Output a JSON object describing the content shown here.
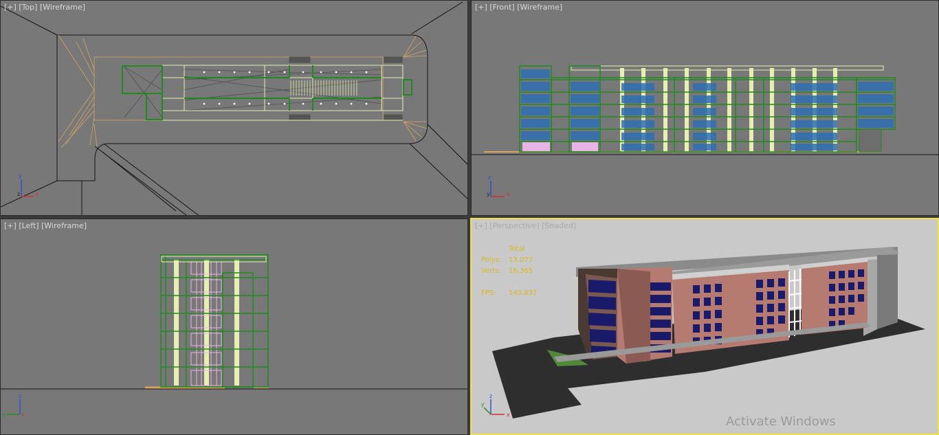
{
  "viewports": {
    "top": {
      "plus": "[+]",
      "view": "[Top]",
      "mode": "[Wireframe]"
    },
    "front": {
      "plus": "[+]",
      "view": "[Front]",
      "mode": "[Wireframe]"
    },
    "left": {
      "plus": "[+]",
      "view": "[Left]",
      "mode": "[Wireframe]"
    },
    "perspective": {
      "plus": "[+]",
      "view": "[Perspective]",
      "mode": "[Shaded]",
      "active": true
    }
  },
  "axes": {
    "x": "x",
    "y": "y",
    "z": "z"
  },
  "stats": {
    "header": "Total",
    "polys_label": "Polys:",
    "polys_value": "13,077",
    "verts_label": "Verts:",
    "verts_value": "16,365",
    "fps_label": "FPS:",
    "fps_value": "143.837"
  },
  "watermark": "Activate Windows",
  "colors": {
    "viewport_bg": "#787878",
    "perspective_bg": "#c9c9c9",
    "active_border": "#f2e04a",
    "wire_green": "#1f8a1f",
    "wire_cream": "#e6efb0",
    "wire_orange": "#d9a460",
    "wire_pink": "#e8b4e6",
    "window_blue": "#2f6fb3",
    "stats_text": "#d8b81e"
  }
}
